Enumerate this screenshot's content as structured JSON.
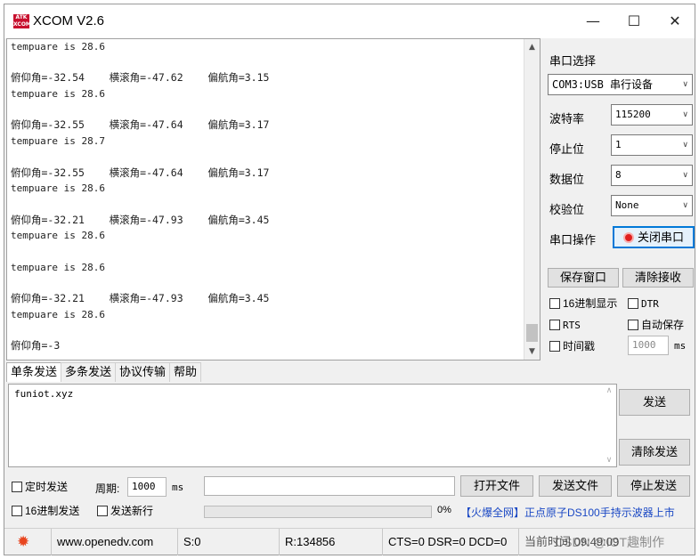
{
  "window": {
    "title": "XCOM V2.6",
    "icon_text": "ATK XCOM",
    "min_glyph": "—",
    "max_glyph": "☐",
    "close_glyph": "✕"
  },
  "receive": {
    "lines": [
      "tempuare is 28.6",
      "",
      "俯仰角=-32.54    横滚角=-47.62    偏航角=3.15",
      "tempuare is 28.6",
      "",
      "俯仰角=-32.55    横滚角=-47.64    偏航角=3.17",
      "tempuare is 28.7",
      "",
      "俯仰角=-32.55    横滚角=-47.64    偏航角=3.17",
      "tempuare is 28.6",
      "",
      "俯仰角=-32.21    横滚角=-47.93    偏航角=3.45",
      "tempuare is 28.6",
      "",
      "tempuare is 28.6",
      "",
      "俯仰角=-32.21    横滚角=-47.93    偏航角=3.45",
      "tempuare is 28.6",
      "",
      "俯仰角=-3"
    ]
  },
  "settings": {
    "port_section": "串口选择",
    "port_value": "COM3:USB 串行设备",
    "baud_label": "波特率",
    "baud_value": "115200",
    "stop_label": "停止位",
    "stop_value": "1",
    "data_label": "数据位",
    "data_value": "8",
    "parity_label": "校验位",
    "parity_value": "None",
    "op_label": "串口操作",
    "op_button": "关闭串口",
    "save_window": "保存窗口",
    "clear_recv": "清除接收",
    "hex_display": "16进制显示",
    "dtr": "DTR",
    "rts": "RTS",
    "auto_save": "自动保存",
    "timestamp": "时间戳",
    "timestamp_value": "1000",
    "timestamp_unit": "ms"
  },
  "tabs": [
    "单条发送",
    "多条发送",
    "协议传输",
    "帮助"
  ],
  "send": {
    "text": "funiot.xyz",
    "send_button": "发送",
    "clear_send_button": "清除发送"
  },
  "bottom": {
    "timed_send": "定时发送",
    "period_label": "周期:",
    "period_value": "1000",
    "period_unit": "ms",
    "open_file": "打开文件",
    "send_file": "发送文件",
    "stop_send": "停止发送",
    "hex_send": "16进制发送",
    "new_line": "发送新行",
    "progress_percent": "0%",
    "promo": "【火爆全网】正点原子DS100手持示波器上市"
  },
  "status": {
    "url": "www.openedv.com",
    "sent": "S:0",
    "received": "R:134856",
    "lines": "CTS=0 DSR=0 DCD=0",
    "time": "当前时间 09:49:09",
    "watermark": "CSDN @IOT趣制作"
  },
  "colors": {
    "title_icon": "#c8102e",
    "close_port_border": "#0078d7",
    "close_port_dot": "#e02020",
    "promo_text": "#1a48c4",
    "gear": "#e8451e"
  }
}
